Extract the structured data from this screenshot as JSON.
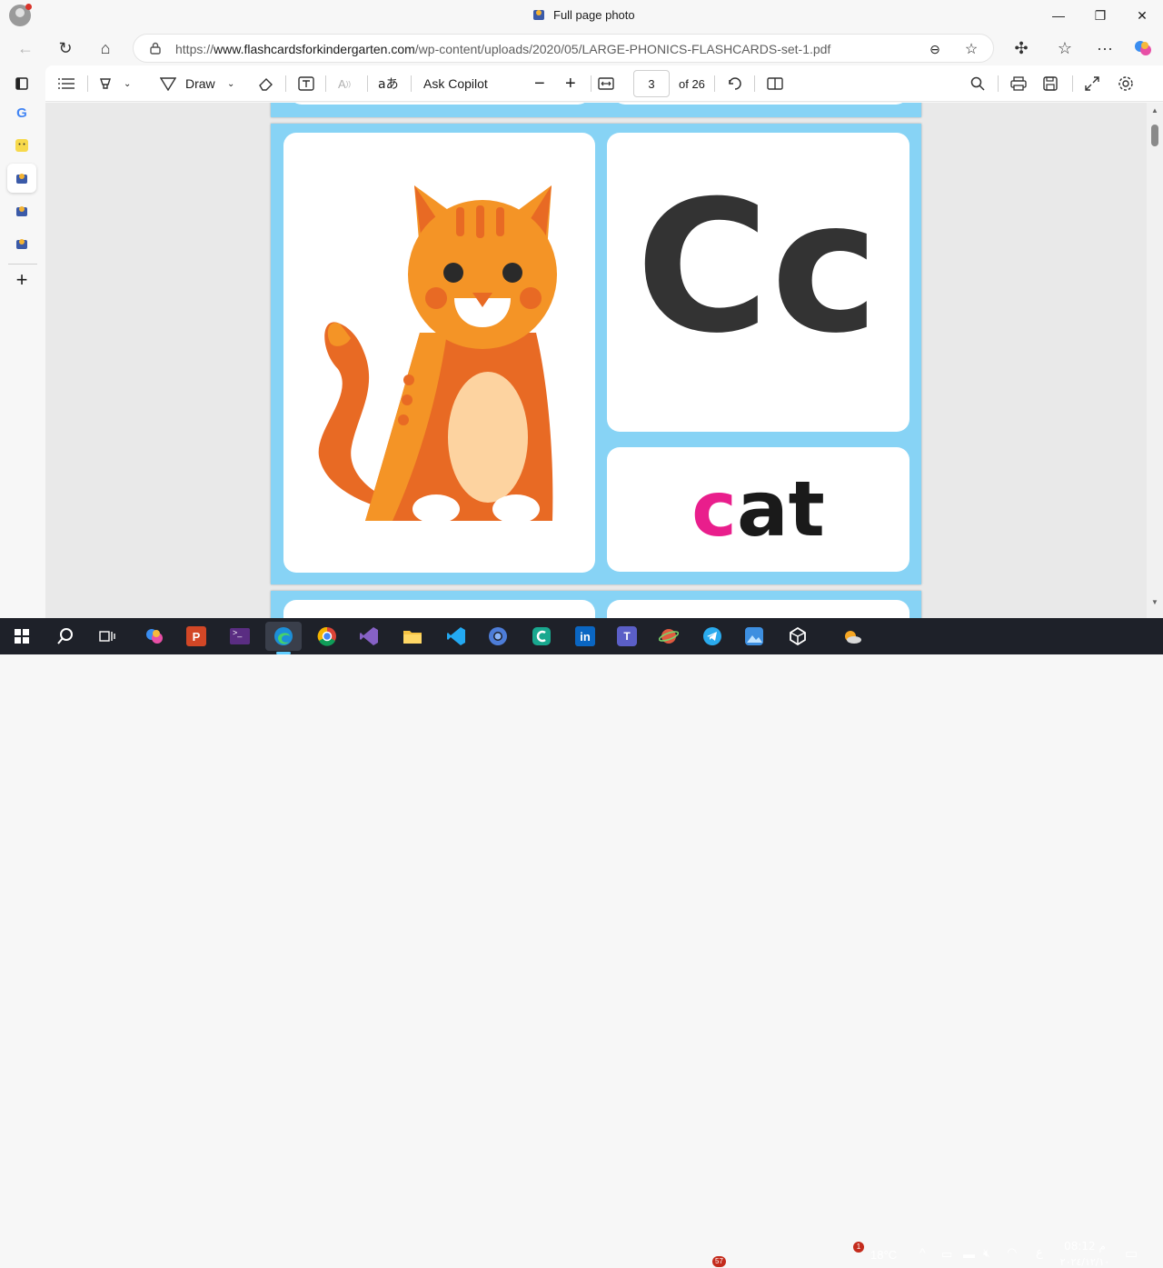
{
  "window": {
    "title": "Full page photo",
    "controls": [
      "minimize",
      "restore",
      "close"
    ]
  },
  "address_bar": {
    "url_prefix": "https://",
    "url_domain": "www.flashcardsforkindergarten.com",
    "url_path": "/wp-content/uploads/2020/05/LARGE-PHONICS-FLASHCARDS-set-1.pdf"
  },
  "pdf_toolbar": {
    "draw_label": "Draw",
    "ask_label": "Ask Copilot",
    "page_current": "3",
    "page_total": "of 26"
  },
  "flashcard": {
    "letters": "Cc",
    "word_first": "c",
    "word_rest": "at",
    "card_background": "#87d3f5",
    "first_letter_color": "#e91e8c"
  },
  "sidebar": {
    "items": [
      "tabs-icon",
      "google-icon",
      "emoji-icon",
      "app-icon",
      "app-icon",
      "app-icon",
      "add-icon"
    ]
  },
  "taskbar": {
    "weather": "18°C",
    "time": "08:12 م",
    "date": "٢٠٢٤/١٢/١٠",
    "lang": "ع",
    "telegram_badge": "57",
    "weather_badge": "1"
  }
}
